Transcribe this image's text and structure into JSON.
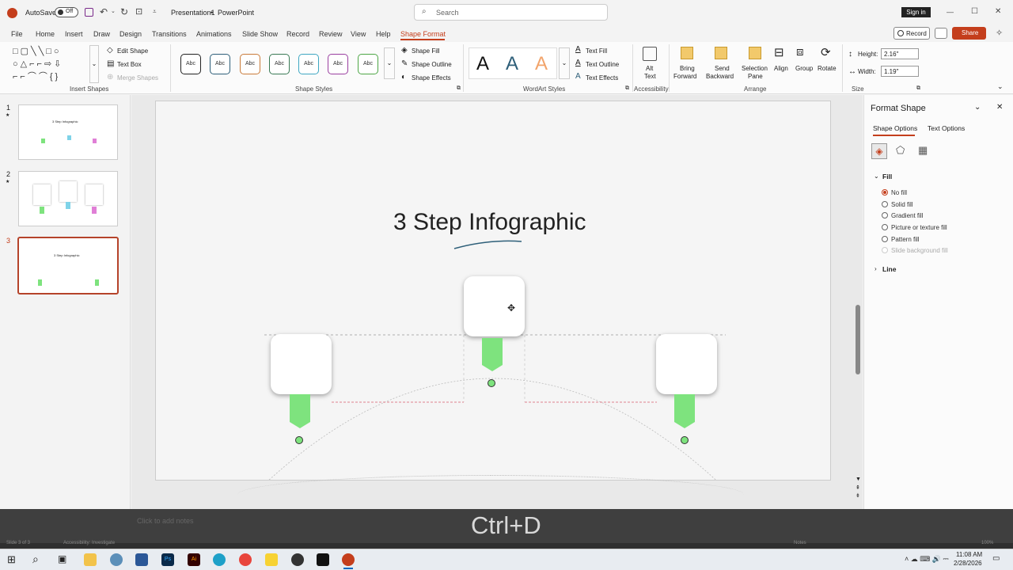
{
  "titlebar": {
    "autosave_label": "AutoSave",
    "autosave_state": "Off",
    "doc_title": "Presentation1",
    "separator": "•",
    "app_name": "PowerPoint",
    "search_placeholder": "Search",
    "signin_label": "Sign in",
    "min_icon": "—",
    "max_icon": "☐",
    "close_icon": "✕"
  },
  "menu": {
    "tabs": [
      "File",
      "Home",
      "Insert",
      "Draw",
      "Design",
      "Transitions",
      "Animations",
      "Slide Show",
      "Record",
      "Review",
      "View",
      "Help",
      "Shape Format"
    ],
    "active_tab": "Shape Format",
    "record_label": "Record",
    "share_label": "Share"
  },
  "ribbon": {
    "insert_shapes": {
      "edit_shape": "Edit Shape",
      "text_box": "Text Box",
      "merge_shapes": "Merge Shapes",
      "group_label": "Insert Shapes"
    },
    "shape_styles": {
      "swatch_label": "Abc",
      "swatch_colors": [
        "#222222",
        "#2e5f79",
        "#c97b3a",
        "#3a7a55",
        "#3fa7c2",
        "#9a3fa0",
        "#4ea646"
      ],
      "shape_fill": "Shape Fill",
      "shape_outline": "Shape Outline",
      "shape_effects": "Shape Effects",
      "group_label": "Shape Styles"
    },
    "wordart": {
      "letter": "A",
      "text_fill": "Text Fill",
      "text_outline": "Text Outline",
      "text_effects": "Text Effects",
      "group_label": "WordArt Styles"
    },
    "accessibility": {
      "alt_text_1": "Alt",
      "alt_text_2": "Text",
      "group_label": "Accessibility"
    },
    "arrange": {
      "bring_forward_1": "Bring",
      "bring_forward_2": "Forward",
      "send_backward_1": "Send",
      "send_backward_2": "Backward",
      "selection_pane_1": "Selection",
      "selection_pane_2": "Pane",
      "align": "Align",
      "group": "Group",
      "rotate": "Rotate",
      "group_label": "Arrange"
    },
    "size": {
      "height_label": "Height:",
      "height_value": "2.16\"",
      "width_label": "Width:",
      "width_value": "1.19\"",
      "group_label": "Size"
    }
  },
  "thumbnails": [
    {
      "number": "1",
      "star": "★",
      "title": "3 Step Infographic"
    },
    {
      "number": "2",
      "star": "★"
    },
    {
      "number": "3",
      "title": "3 Step Infographic"
    }
  ],
  "slide": {
    "title": "3 Step Infographic",
    "notes_placeholder": "Click to add notes"
  },
  "format_pane": {
    "title": "Format Shape",
    "tab_shape_options": "Shape Options",
    "tab_text_options": "Text Options",
    "fill_section": "Fill",
    "options": [
      "No fill",
      "Solid fill",
      "Gradient fill",
      "Picture or texture fill",
      "Pattern fill",
      "Slide background fill"
    ],
    "selected_option": "No fill",
    "line_section": "Line"
  },
  "overlay": {
    "shortcut": "Ctrl+D"
  },
  "statusbar": {
    "slide_info": "Slide 3 of 3",
    "accessibility": "Accessibility: Investigate",
    "notes": "Notes",
    "zoom": "100%"
  },
  "taskbar": {
    "time": "11:08 AM",
    "date": "2/28/2026"
  },
  "colors": {
    "accent": "#c43e1c",
    "green": "#7ee37e",
    "teal_line": "#2e5f79"
  }
}
